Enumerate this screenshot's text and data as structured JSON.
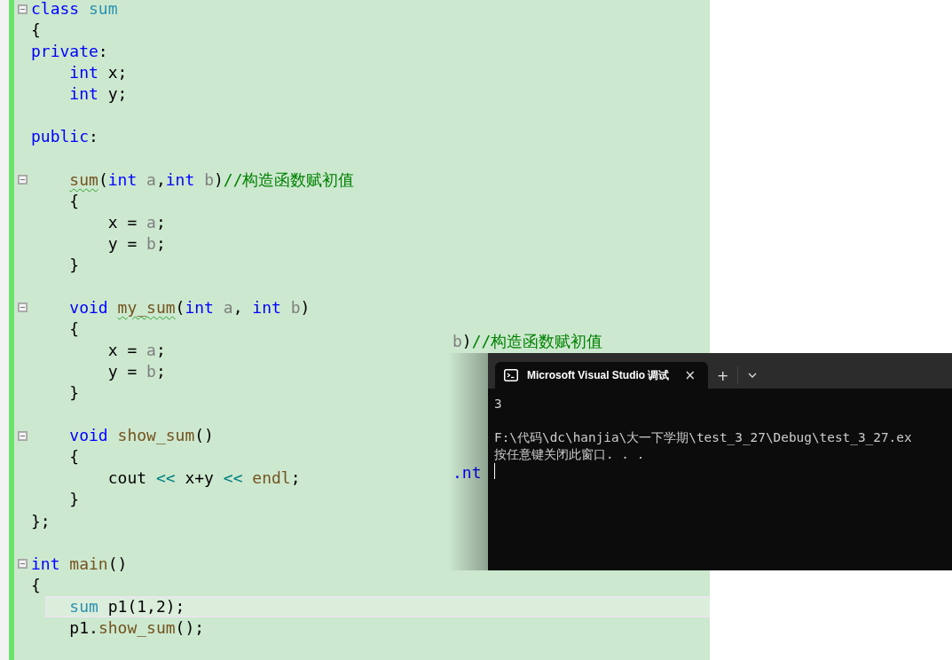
{
  "editor": {
    "lines": [
      {
        "kind": "code",
        "foldable": true,
        "current": false,
        "tokens": [
          {
            "kind": "kw",
            "text": "class"
          },
          {
            "kind": "cls",
            "text": " sum"
          }
        ]
      },
      {
        "kind": "code",
        "foldable": false,
        "current": false,
        "tokens": [
          {
            "kind": "txt",
            "text": "{"
          }
        ]
      },
      {
        "kind": "code",
        "foldable": false,
        "current": false,
        "tokens": [
          {
            "kind": "kw",
            "text": "private"
          },
          {
            "kind": "txt",
            "text": ":"
          }
        ]
      },
      {
        "kind": "code",
        "foldable": false,
        "current": false,
        "tokens": [
          {
            "kind": "kw",
            "text": "    int"
          },
          {
            "kind": "txt",
            "text": " x;"
          }
        ]
      },
      {
        "kind": "code",
        "foldable": false,
        "current": false,
        "tokens": [
          {
            "kind": "kw",
            "text": "    int"
          },
          {
            "kind": "txt",
            "text": " y;"
          }
        ]
      },
      {
        "kind": "blank",
        "foldable": false,
        "current": false
      },
      {
        "kind": "code",
        "foldable": false,
        "current": false,
        "tokens": [
          {
            "kind": "kw",
            "text": "public"
          },
          {
            "kind": "txt",
            "text": ":"
          }
        ]
      },
      {
        "kind": "blank",
        "foldable": false,
        "current": false
      },
      {
        "kind": "code",
        "foldable": true,
        "current": false,
        "tokens": [
          {
            "kind": "fn_err",
            "text": "    sum"
          },
          {
            "kind": "txt",
            "text": "("
          },
          {
            "kind": "kw",
            "text": "int"
          },
          {
            "kind": "param",
            "text": " a"
          },
          {
            "kind": "txt",
            "text": ","
          },
          {
            "kind": "kw",
            "text": "int"
          },
          {
            "kind": "param",
            "text": " b"
          },
          {
            "kind": "txt",
            "text": ")"
          },
          {
            "kind": "cmt",
            "text": "//构造函数赋初值"
          }
        ]
      },
      {
        "kind": "code",
        "foldable": false,
        "current": false,
        "tokens": [
          {
            "kind": "txt",
            "text": "    {"
          }
        ]
      },
      {
        "kind": "code",
        "foldable": false,
        "current": false,
        "tokens": [
          {
            "kind": "txt",
            "text": "        x = "
          },
          {
            "kind": "param",
            "text": "a"
          },
          {
            "kind": "txt",
            "text": ";"
          }
        ]
      },
      {
        "kind": "code",
        "foldable": false,
        "current": false,
        "tokens": [
          {
            "kind": "txt",
            "text": "        y = "
          },
          {
            "kind": "param",
            "text": "b"
          },
          {
            "kind": "txt",
            "text": ";"
          }
        ]
      },
      {
        "kind": "code",
        "foldable": false,
        "current": false,
        "tokens": [
          {
            "kind": "txt",
            "text": "    }"
          }
        ]
      },
      {
        "kind": "blank",
        "foldable": false,
        "current": false
      },
      {
        "kind": "code",
        "foldable": true,
        "current": false,
        "tokens": [
          {
            "kind": "kw",
            "text": "    void"
          },
          {
            "kind": "fn_err",
            "text": " my_sum"
          },
          {
            "kind": "txt",
            "text": "("
          },
          {
            "kind": "kw",
            "text": "int"
          },
          {
            "kind": "param",
            "text": " a"
          },
          {
            "kind": "txt",
            "text": ","
          },
          {
            "kind": "kw",
            "text": " int"
          },
          {
            "kind": "param",
            "text": " b"
          },
          {
            "kind": "txt",
            "text": ")"
          }
        ]
      },
      {
        "kind": "code",
        "foldable": false,
        "current": false,
        "tokens": [
          {
            "kind": "txt",
            "text": "    {"
          }
        ]
      },
      {
        "kind": "code",
        "foldable": false,
        "current": false,
        "tokens": [
          {
            "kind": "txt",
            "text": "        x = "
          },
          {
            "kind": "param",
            "text": "a"
          },
          {
            "kind": "txt",
            "text": ";"
          }
        ]
      },
      {
        "kind": "code",
        "foldable": false,
        "current": false,
        "tokens": [
          {
            "kind": "txt",
            "text": "        y = "
          },
          {
            "kind": "param",
            "text": "b"
          },
          {
            "kind": "txt",
            "text": ";"
          }
        ]
      },
      {
        "kind": "code",
        "foldable": false,
        "current": false,
        "tokens": [
          {
            "kind": "txt",
            "text": "    }"
          }
        ]
      },
      {
        "kind": "blank",
        "foldable": false,
        "current": false
      },
      {
        "kind": "code",
        "foldable": true,
        "current": false,
        "tokens": [
          {
            "kind": "kw",
            "text": "    void"
          },
          {
            "kind": "fn",
            "text": " show_sum"
          },
          {
            "kind": "txt",
            "text": "()"
          }
        ]
      },
      {
        "kind": "code",
        "foldable": false,
        "current": false,
        "tokens": [
          {
            "kind": "txt",
            "text": "    {"
          }
        ]
      },
      {
        "kind": "code",
        "foldable": false,
        "current": false,
        "tokens": [
          {
            "kind": "txt",
            "text": "        cout"
          },
          {
            "kind": "op",
            "text": " <<"
          },
          {
            "kind": "txt",
            "text": " x+y"
          },
          {
            "kind": "op",
            "text": " <<"
          },
          {
            "kind": "fn",
            "text": " endl"
          },
          {
            "kind": "txt",
            "text": ";"
          }
        ]
      },
      {
        "kind": "code",
        "foldable": false,
        "current": false,
        "tokens": [
          {
            "kind": "txt",
            "text": "    }"
          }
        ]
      },
      {
        "kind": "code",
        "foldable": false,
        "current": false,
        "tokens": [
          {
            "kind": "txt",
            "text": "};"
          }
        ]
      },
      {
        "kind": "blank",
        "foldable": false,
        "current": false
      },
      {
        "kind": "code",
        "foldable": true,
        "current": false,
        "tokens": [
          {
            "kind": "kw",
            "text": "int"
          },
          {
            "kind": "fn",
            "text": " main"
          },
          {
            "kind": "txt",
            "text": "()"
          }
        ]
      },
      {
        "kind": "code",
        "foldable": false,
        "current": false,
        "tokens": [
          {
            "kind": "txt",
            "text": "{"
          }
        ]
      },
      {
        "kind": "code",
        "foldable": false,
        "current": true,
        "tokens": [
          {
            "kind": "cls",
            "text": "    sum"
          },
          {
            "kind": "txt",
            "text": " p1(1,2);"
          }
        ]
      },
      {
        "kind": "code",
        "foldable": false,
        "current": false,
        "tokens": [
          {
            "kind": "txt",
            "text": "    p1."
          },
          {
            "kind": "fn",
            "text": "show_sum"
          },
          {
            "kind": "txt",
            "text": "();"
          }
        ]
      },
      {
        "kind": "blank",
        "foldable": false,
        "current": false
      }
    ],
    "ghost_fragments": [
      {
        "tokens": [
          {
            "kind": "param",
            "text": "b"
          },
          {
            "kind": "txt",
            "text": ")"
          },
          {
            "kind": "cmt",
            "text": "//构造函数赋初值"
          }
        ]
      },
      {
        "tokens": [
          {
            "kind": "kw",
            "text": ".nt"
          }
        ]
      }
    ]
  },
  "terminal": {
    "tab_title": "Microsoft Visual Studio 调试",
    "tab_close": "×",
    "new_tab": "+",
    "output_blocks": [
      {
        "lines": [
          "3"
        ]
      },
      {
        "lines": [
          "F:\\代码\\dc\\hanjia\\大一下学期\\test_3_27\\Debug\\test_3_27.ex",
          "按任意键关闭此窗口. . ."
        ]
      }
    ]
  }
}
